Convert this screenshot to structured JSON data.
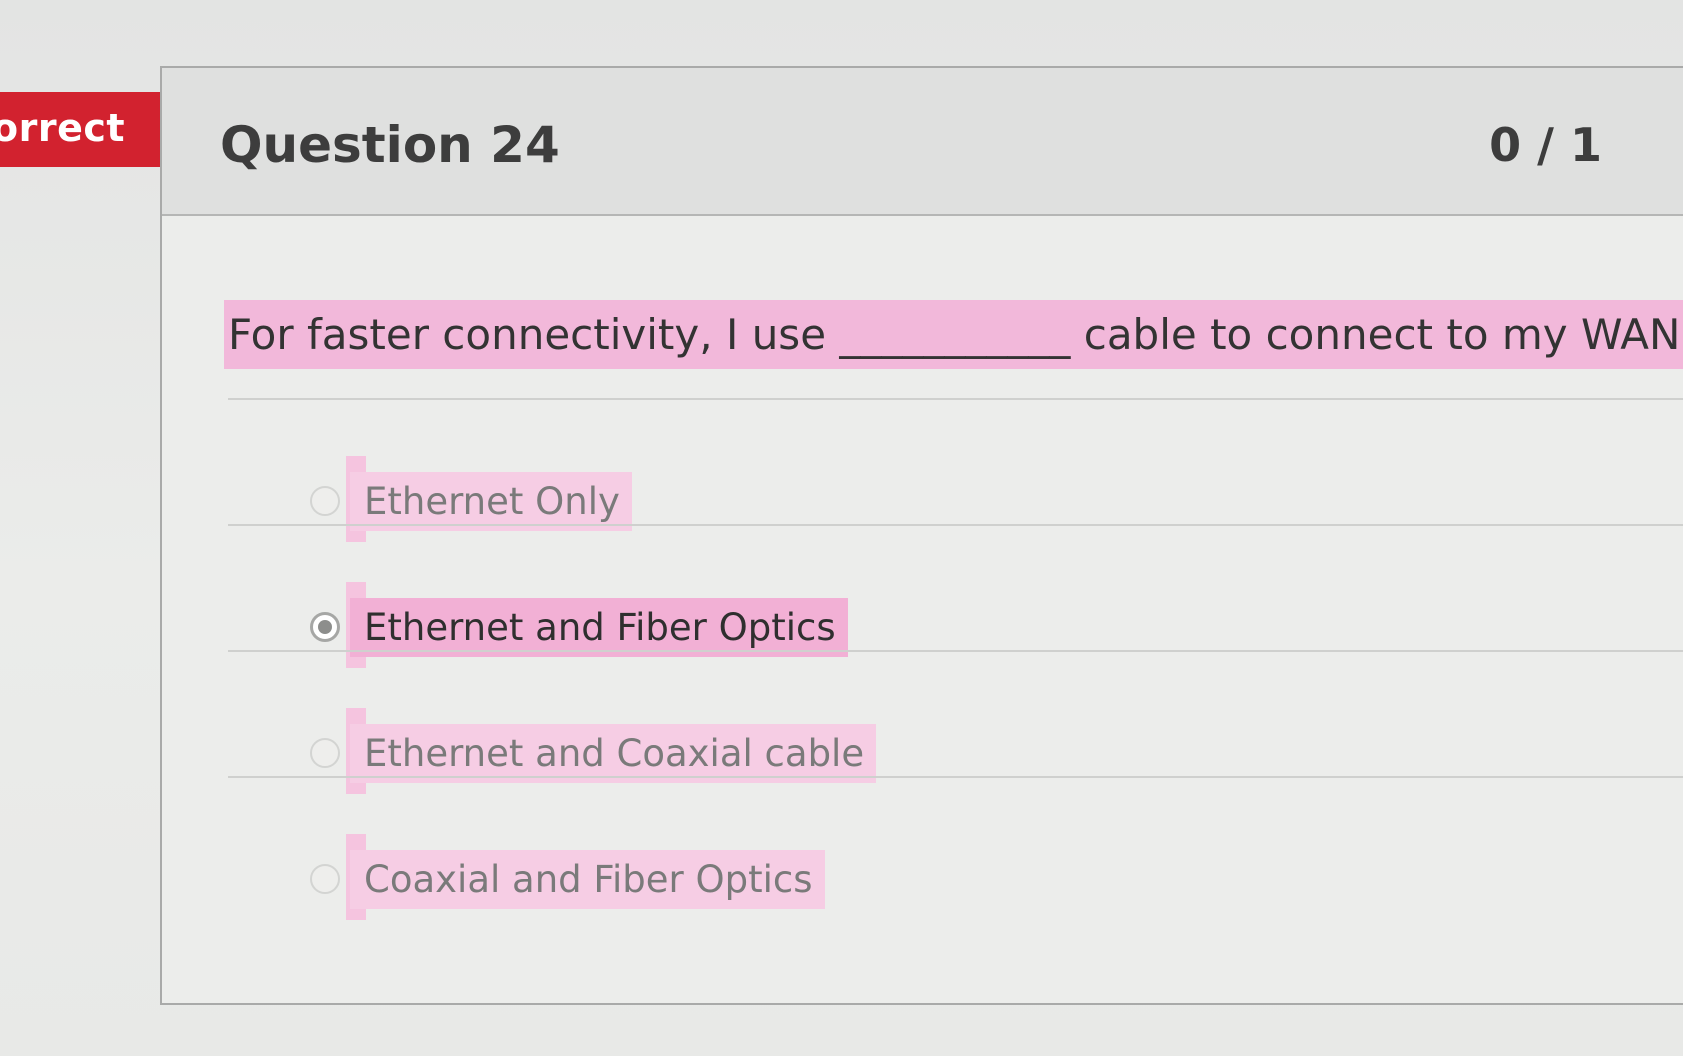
{
  "status": {
    "label": "orrect",
    "color": "#d2222f"
  },
  "question": {
    "title": "Question 24",
    "score": "0 / 1",
    "prompt": "For faster connectivity, I use ___________ cable to connect to my WAN."
  },
  "options": [
    {
      "label": "Ethernet Only",
      "selected": false
    },
    {
      "label": "Ethernet and Fiber Optics",
      "selected": true
    },
    {
      "label": "Ethernet and Coaxial cable",
      "selected": false
    },
    {
      "label": "Coaxial and Fiber Optics",
      "selected": false
    }
  ],
  "colors": {
    "highlight": "#f2b8da",
    "page_background": "#e6e7e6"
  }
}
